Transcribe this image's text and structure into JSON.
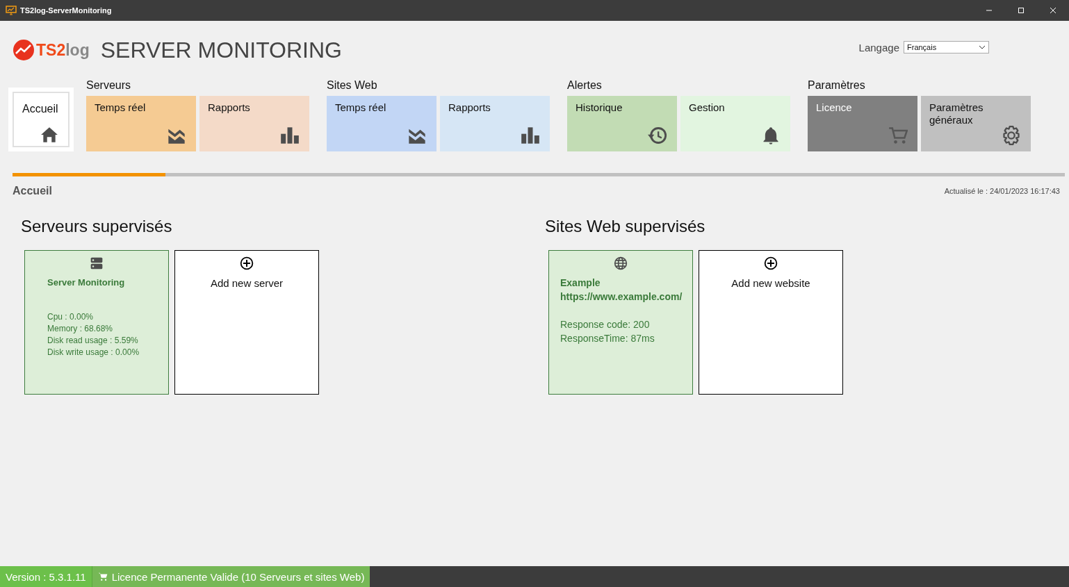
{
  "window": {
    "title": "TS2log-ServerMonitoring"
  },
  "header": {
    "logo_text": "TS2",
    "logo_text_2": "log",
    "title": "SERVER MONITORING",
    "language_label": "Langage",
    "language_value": "Français"
  },
  "home_tile": {
    "label": "Accueil",
    "selected": true
  },
  "nav_groups": [
    {
      "title": "Serveurs",
      "tiles": [
        {
          "label": "Temps réel",
          "kind": "realtime",
          "color": "#f5cb93",
          "selected": false
        },
        {
          "label": "Rapports",
          "kind": "reports",
          "color": "#f4dac8",
          "selected": false
        }
      ]
    },
    {
      "title": "Sites Web",
      "tiles": [
        {
          "label": "Temps réel",
          "kind": "realtime",
          "color": "#c2d6f5",
          "selected": false
        },
        {
          "label": "Rapports",
          "kind": "reports",
          "color": "#d6e6f5",
          "selected": false
        }
      ]
    },
    {
      "title": "Alertes",
      "tiles": [
        {
          "label": "Historique",
          "kind": "history",
          "color": "#c2dcb4",
          "selected": false
        },
        {
          "label": "Gestion",
          "kind": "bell",
          "color": "#e2f5e0",
          "selected": false
        }
      ]
    },
    {
      "title": "Paramètres",
      "tiles": [
        {
          "label": "Licence",
          "kind": "cart",
          "color": "#808080",
          "selected": false
        },
        {
          "label": "Paramètres généraux",
          "kind": "gear",
          "color": "#c0c0c0",
          "selected": false
        }
      ]
    }
  ],
  "progress": {
    "level": 0.145
  },
  "breadcrumb": "Accueil",
  "updated": "Actualisé le : 24/01/2023 16:17:43",
  "sections": [
    {
      "title": "Serveurs supervisés",
      "cards": [
        {
          "kind": "server",
          "color": "#ddeed8",
          "name": "Server Monitoring",
          "lines": [
            "Cpu : 0.00%",
            "Memory : 68.68%",
            "Disk read usage : 5.59%",
            "Disk write usage : 0.00%"
          ]
        },
        {
          "kind": "add",
          "label": "Add new server"
        }
      ]
    },
    {
      "title": "Sites Web supervisés",
      "cards": [
        {
          "kind": "website",
          "color": "#ddeed8",
          "name": "Example https://www.example.com/",
          "lines": [
            "Response code: 200",
            "ResponseTime: 87ms"
          ]
        },
        {
          "kind": "add",
          "label": "Add new website"
        }
      ]
    }
  ],
  "status_bar": {
    "version": "Version : 5.3.1.11",
    "licence": "Licence Permanente Valide (10 Serveurs et sites Web)"
  }
}
